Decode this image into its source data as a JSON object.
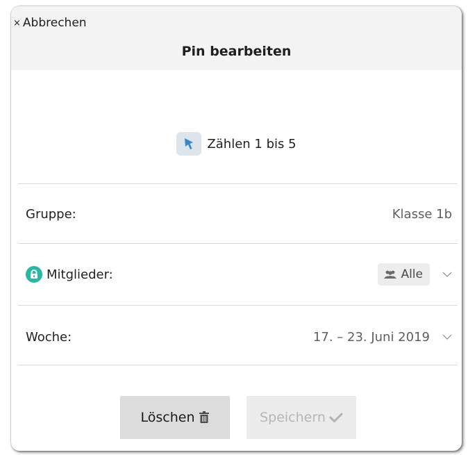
{
  "header": {
    "cancel_label": "Abbrechen",
    "cancel_symbol": "×",
    "title": "Pin bearbeiten"
  },
  "pin": {
    "icon": "pin-icon",
    "name": "Zählen 1 bis 5"
  },
  "rows": {
    "group": {
      "label": "Gruppe:",
      "value": "Klasse 1b"
    },
    "members": {
      "label": "Mitglieder:",
      "value": "Alle",
      "icon": "lock-icon",
      "value_icon": "group-icon"
    },
    "week": {
      "label": "Woche:",
      "value": "17. – 23. Juni 2019"
    }
  },
  "buttons": {
    "delete_label": "Löschen",
    "save_label": "Speichern"
  },
  "colors": {
    "accent_teal": "#2bb6a5",
    "pin_blue": "#3d86c6",
    "header_bg": "#f3f3f3"
  }
}
